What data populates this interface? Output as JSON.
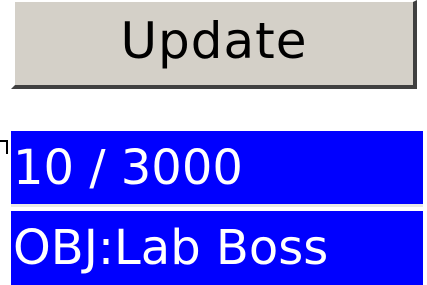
{
  "toolbar": {
    "update_label": "Update"
  },
  "status": {
    "counter": "10 / 3000",
    "objective": "OBJ:Lab Boss"
  },
  "colors": {
    "button_face": "#d4d0c8",
    "field_background": "#0000ff",
    "field_text": "#ffffff"
  }
}
